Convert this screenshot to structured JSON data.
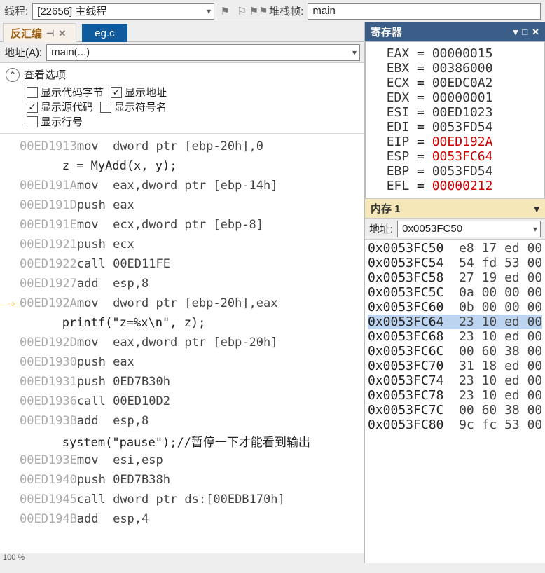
{
  "toolbar": {
    "thread_label": "线程:",
    "thread_value": "[22656] 主线程",
    "stack_label": "堆栈帧:",
    "stack_value": "main"
  },
  "disasm_panel": {
    "title": "反汇编",
    "file_tab": "eg.c",
    "addr_label": "地址(A):",
    "addr_value": "main(...)",
    "options_title": "查看选项",
    "checkboxes": {
      "show_bytes": {
        "label": "显示代码字节",
        "checked": false
      },
      "show_address": {
        "label": "显示地址",
        "checked": true
      },
      "show_source": {
        "label": "显示源代码",
        "checked": true
      },
      "show_symbol": {
        "label": "显示符号名",
        "checked": false
      },
      "show_lineno": {
        "label": "显示行号",
        "checked": false
      }
    }
  },
  "disasm_lines": [
    {
      "type": "asm",
      "addr": "00ED1913",
      "op": "mov  ",
      "args": "dword ptr [ebp-20h],0"
    },
    {
      "type": "src",
      "text": "   z = MyAdd(x, y);"
    },
    {
      "type": "asm",
      "addr": "00ED191A",
      "op": "mov  ",
      "args": "eax,dword ptr [ebp-14h]"
    },
    {
      "type": "asm",
      "addr": "00ED191D",
      "op": "push ",
      "args": "eax"
    },
    {
      "type": "asm",
      "addr": "00ED191E",
      "op": "mov  ",
      "args": "ecx,dword ptr [ebp-8]"
    },
    {
      "type": "asm",
      "addr": "00ED1921",
      "op": "push ",
      "args": "ecx"
    },
    {
      "type": "asm",
      "addr": "00ED1922",
      "op": "call ",
      "args": "00ED11FE"
    },
    {
      "type": "asm",
      "addr": "00ED1927",
      "op": "add  ",
      "args": "esp,8"
    },
    {
      "type": "asm",
      "addr": "00ED192A",
      "op": "mov  ",
      "args": "dword ptr [ebp-20h],eax",
      "current": true
    },
    {
      "type": "src",
      "text": "   printf(\"z=%x\\n\", z);"
    },
    {
      "type": "asm",
      "addr": "00ED192D",
      "op": "mov  ",
      "args": "eax,dword ptr [ebp-20h]"
    },
    {
      "type": "asm",
      "addr": "00ED1930",
      "op": "push ",
      "args": "eax"
    },
    {
      "type": "asm",
      "addr": "00ED1931",
      "op": "push ",
      "args": "0ED7B30h"
    },
    {
      "type": "asm",
      "addr": "00ED1936",
      "op": "call ",
      "args": "00ED10D2"
    },
    {
      "type": "asm",
      "addr": "00ED193B",
      "op": "add  ",
      "args": "esp,8"
    },
    {
      "type": "src",
      "text": "   system(\"pause\");//暂停一下才能看到输出"
    },
    {
      "type": "asm",
      "addr": "00ED193E",
      "op": "mov  ",
      "args": "esi,esp"
    },
    {
      "type": "asm",
      "addr": "00ED1940",
      "op": "push ",
      "args": "0ED7B38h"
    },
    {
      "type": "asm",
      "addr": "00ED1945",
      "op": "call ",
      "args": "dword ptr ds:[00EDB170h]"
    },
    {
      "type": "asm",
      "addr": "00ED194B",
      "op": "add  ",
      "args": "esp,4"
    }
  ],
  "registers_panel": {
    "title": "寄存器"
  },
  "registers": [
    {
      "name": "EAX",
      "value": "00000015",
      "changed": false
    },
    {
      "name": "EBX",
      "value": "00386000",
      "changed": false
    },
    {
      "name": "ECX",
      "value": "00EDC0A2",
      "changed": false
    },
    {
      "name": "EDX",
      "value": "00000001",
      "changed": false
    },
    {
      "name": "ESI",
      "value": "00ED1023",
      "changed": false
    },
    {
      "name": "EDI",
      "value": "0053FD54",
      "changed": false
    },
    {
      "name": "EIP",
      "value": "00ED192A",
      "changed": true
    },
    {
      "name": "ESP",
      "value": "0053FC64",
      "changed": true
    },
    {
      "name": "EBP",
      "value": "0053FD54",
      "changed": false
    },
    {
      "name": "EFL",
      "value": "00000212",
      "changed": true
    }
  ],
  "memory_panel": {
    "title": "内存 1",
    "addr_label": "地址:",
    "addr_value": "0x0053FC50"
  },
  "memory_lines": [
    {
      "addr": "0x0053FC50",
      "bytes": "e8 17 ed 00"
    },
    {
      "addr": "0x0053FC54",
      "bytes": "54 fd 53 00"
    },
    {
      "addr": "0x0053FC58",
      "bytes": "27 19 ed 00"
    },
    {
      "addr": "0x0053FC5C",
      "bytes": "0a 00 00 00"
    },
    {
      "addr": "0x0053FC60",
      "bytes": "0b 00 00 00"
    },
    {
      "addr": "0x0053FC64",
      "bytes": "23 10 ed 00",
      "selected": true
    },
    {
      "addr": "0x0053FC68",
      "bytes": "23 10 ed 00"
    },
    {
      "addr": "0x0053FC6C",
      "bytes": "00 60 38 00"
    },
    {
      "addr": "0x0053FC70",
      "bytes": "31 18 ed 00"
    },
    {
      "addr": "0x0053FC74",
      "bytes": "23 10 ed 00"
    },
    {
      "addr": "0x0053FC78",
      "bytes": "23 10 ed 00"
    },
    {
      "addr": "0x0053FC7C",
      "bytes": "00 60 38 00"
    },
    {
      "addr": "0x0053FC80",
      "bytes": "9c fc 53 00"
    }
  ],
  "zoom": "100 %"
}
